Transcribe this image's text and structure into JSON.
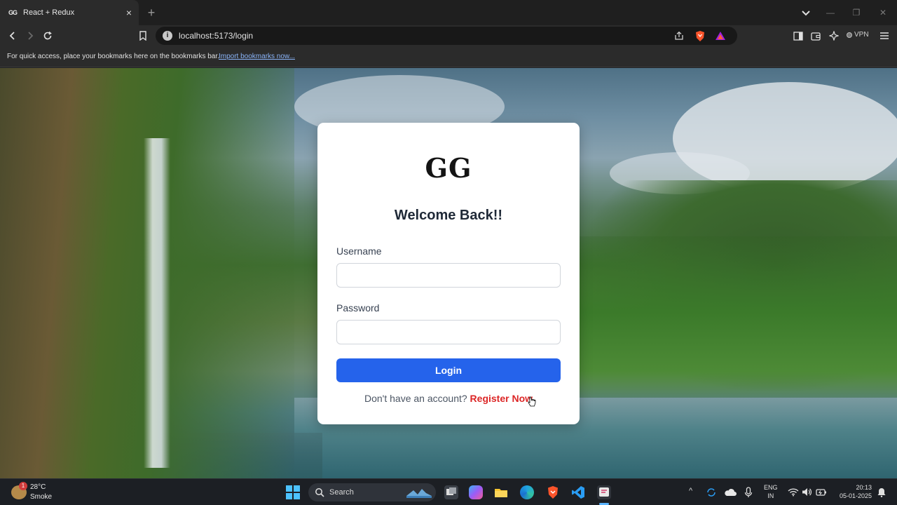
{
  "browser": {
    "tab": {
      "favicon_text": "GG",
      "title": "React + Redux",
      "close_glyph": "×"
    },
    "new_tab_glyph": "+",
    "window_controls": {
      "minimize": "—",
      "maximize": "❐",
      "close": "✕"
    },
    "address": {
      "info_glyph": "i",
      "url": "localhost:5173/login"
    },
    "vpn_label": "VPN",
    "bookmarks_bar": {
      "message": "For quick access, place your bookmarks here on the bookmarks bar.",
      "link": "Import bookmarks now..."
    },
    "icons": [
      "back-icon",
      "forward-icon",
      "reload-icon",
      "bookmark-icon",
      "share-icon",
      "brave-shield-icon",
      "brave-rewards-icon",
      "sidebar-icon",
      "wallet-icon",
      "leo-ai-icon",
      "menu-icon"
    ]
  },
  "login": {
    "logo": "GG",
    "heading": "Welcome Back!!",
    "username_label": "Username",
    "username_value": "",
    "password_label": "Password",
    "password_value": "",
    "login_button": "Login",
    "register_prompt": "Don't have an account?",
    "register_link": "Register Now"
  },
  "colors": {
    "primary": "#2563eb",
    "link": "#dc2626",
    "heading": "#1f2937"
  },
  "taskbar": {
    "weather": {
      "badge": "1",
      "temp": "28°C",
      "condition": "Smoke"
    },
    "search_placeholder": "Search",
    "apps": [
      "task-view-icon",
      "copilot-icon",
      "file-explorer-icon",
      "edge-icon",
      "brave-icon",
      "vscode-icon",
      "snipping-tool-icon"
    ],
    "tray": {
      "chevron": "^",
      "lang_top": "ENG",
      "lang_bottom": "IN",
      "time": "20:13",
      "date": "05-01-2025"
    }
  }
}
